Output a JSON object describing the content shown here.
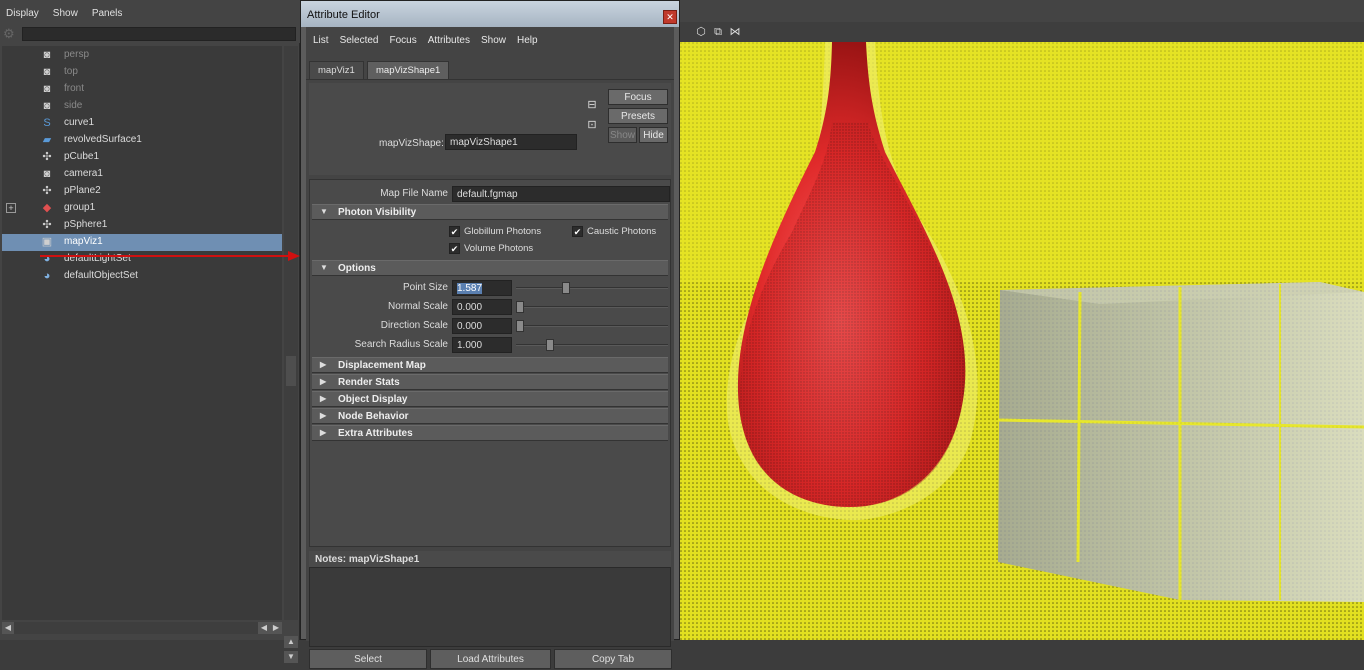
{
  "outliner": {
    "menu": [
      "Display",
      "Show",
      "Panels"
    ],
    "items": [
      {
        "label": "persp",
        "icon": "camera-icon",
        "dim": true
      },
      {
        "label": "top",
        "icon": "camera-icon",
        "dim": true
      },
      {
        "label": "front",
        "icon": "camera-icon",
        "dim": true
      },
      {
        "label": "side",
        "icon": "camera-icon",
        "dim": true
      },
      {
        "label": "curve1",
        "icon": "curve-icon",
        "dim": false
      },
      {
        "label": "revolvedSurface1",
        "icon": "nurbs-surface-icon",
        "dim": false
      },
      {
        "label": "pCube1",
        "icon": "mesh-icon",
        "dim": false
      },
      {
        "label": "camera1",
        "icon": "camera-icon",
        "dim": false
      },
      {
        "label": "pPlane2",
        "icon": "mesh-icon",
        "dim": false
      },
      {
        "label": "group1",
        "icon": "group-icon",
        "dim": false,
        "expandable": true
      },
      {
        "label": "pSphere1",
        "icon": "mesh-icon",
        "dim": false
      },
      {
        "label": "mapViz1",
        "icon": "mapviz-icon",
        "dim": false,
        "selected": true
      },
      {
        "label": "defaultLightSet",
        "icon": "set-icon",
        "dim": false
      },
      {
        "label": "defaultObjectSet",
        "icon": "set-icon",
        "dim": false
      }
    ]
  },
  "ae": {
    "title": "Attribute Editor",
    "menu": [
      "List",
      "Selected",
      "Focus",
      "Attributes",
      "Show",
      "Help"
    ],
    "tabs": [
      "mapViz1",
      "mapVizShape1"
    ],
    "active_tab": 1,
    "shape_label": "mapVizShape:",
    "shape_value": "mapVizShape1",
    "buttons": {
      "focus": "Focus",
      "presets": "Presets",
      "show": "Show",
      "hide": "Hide"
    },
    "map_file_label": "Map File Name",
    "map_file_value": "default.fgmap",
    "sections": {
      "photon_visibility": "Photon Visibility",
      "options": "Options",
      "collapsed": [
        "Displacement Map",
        "Render Stats",
        "Object Display",
        "Node Behavior",
        "Extra Attributes"
      ]
    },
    "checkboxes": [
      {
        "label": "Globillum Photons",
        "checked": true
      },
      {
        "label": "Caustic Photons",
        "checked": true
      },
      {
        "label": "Volume Photons",
        "checked": true
      }
    ],
    "options": [
      {
        "label": "Point Size",
        "value": "1.587",
        "slider": 0.33,
        "selected": true
      },
      {
        "label": "Normal Scale",
        "value": "0.000",
        "slider": 0.0
      },
      {
        "label": "Direction Scale",
        "value": "0.000",
        "slider": 0.0
      },
      {
        "label": "Search Radius Scale",
        "value": "1.000",
        "slider": 0.2
      }
    ],
    "notes_label": "Notes:  mapVizShape1",
    "bottom_buttons": [
      "Select",
      "Load Attributes",
      "Copy Tab"
    ]
  },
  "colors": {
    "viewport_bg": "#d9d822",
    "vase": "#e02a2a",
    "selection": "#6f8fb3",
    "arrow": "#d01010"
  }
}
